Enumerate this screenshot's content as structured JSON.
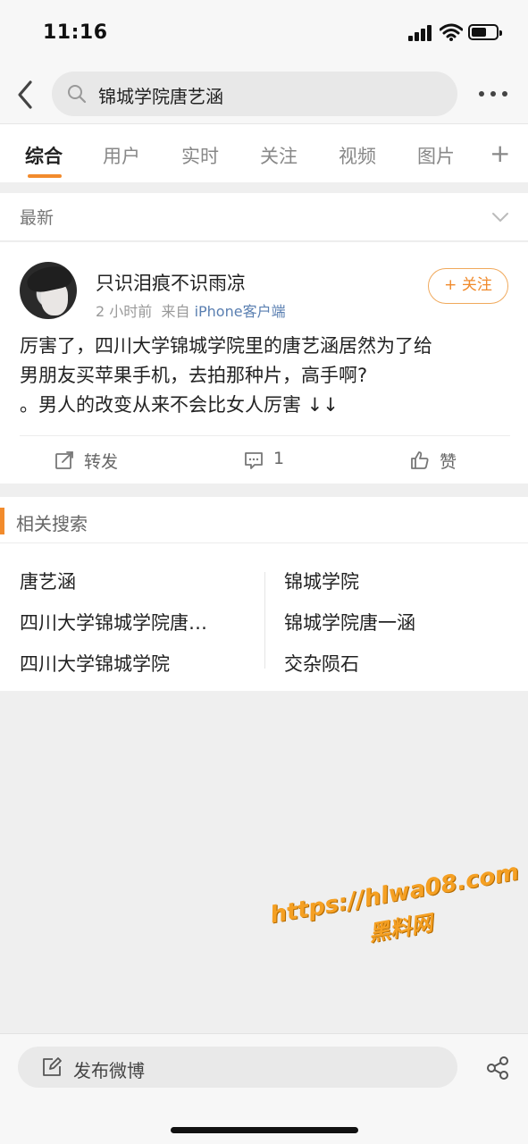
{
  "status": {
    "time": "11:16"
  },
  "search": {
    "query": "锦城学院唐艺涵"
  },
  "tabs": [
    {
      "label": "综合"
    },
    {
      "label": "用户"
    },
    {
      "label": "实时"
    },
    {
      "label": "关注"
    },
    {
      "label": "视频"
    },
    {
      "label": "图片"
    }
  ],
  "tab_plus": "+",
  "latest": {
    "label": "最新"
  },
  "post": {
    "user_name": "只识泪痕不识雨凉",
    "time": "2 小时前",
    "source_prefix": "来自",
    "source": "iPhone客户端",
    "follow_label": "+ 关注",
    "text_lines": [
      "厉害了，四川大学锦城学院里的唐艺涵居然为了给",
      "男朋友买苹果手机，去拍那种片，高手啊?",
      " 。男人的改变从来不会比女人厉害 ↓↓"
    ],
    "actions": {
      "repost": "转发",
      "comment": "1",
      "like": "赞"
    }
  },
  "related": {
    "title": "相关搜索",
    "left": [
      "唐艺涵",
      "四川大学锦城学院唐…",
      "四川大学锦城学院"
    ],
    "right": [
      "锦城学院",
      "锦城学院唐一涵",
      "交杂陨石"
    ]
  },
  "watermark": {
    "url": "https://hlwa08.com",
    "label": "黑料网"
  },
  "bottom": {
    "compose_label": "发布微博"
  },
  "colors": {
    "accent": "#f28b2c",
    "link": "#5a7fb1"
  }
}
